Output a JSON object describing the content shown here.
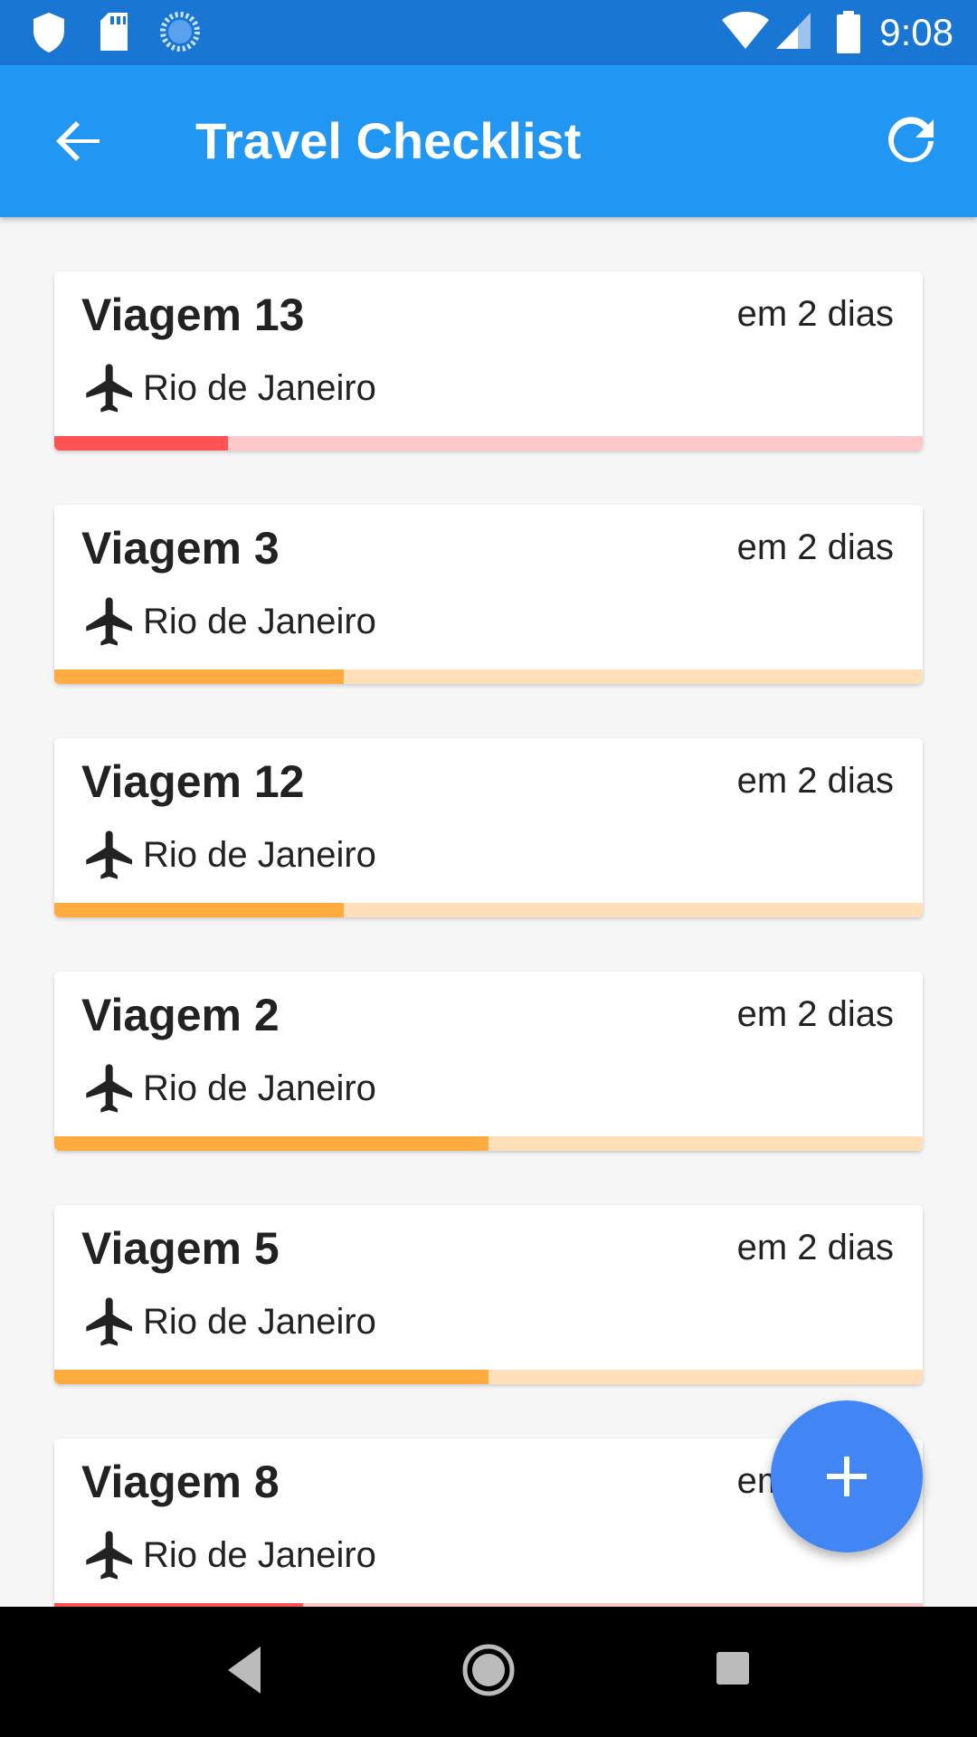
{
  "status_bar": {
    "time": "9:08",
    "icons": [
      "shield-icon",
      "sd-card-icon",
      "loading-icon",
      "wifi-icon",
      "signal-icon",
      "battery-icon"
    ]
  },
  "app_bar": {
    "title": "Travel Checklist",
    "back_icon": "arrow-back-icon",
    "refresh_icon": "refresh-icon",
    "color": "#2196f3"
  },
  "trips": [
    {
      "name": "Viagem 13",
      "due": "em 2 dias",
      "destination": "Rio de Janeiro",
      "progress": 0.2,
      "fill_color": "#ff5252",
      "track_color": "#ffc9c9"
    },
    {
      "name": "Viagem 3",
      "due": "em 2 dias",
      "destination": "Rio de Janeiro",
      "progress": 0.333,
      "fill_color": "#ffab40",
      "track_color": "#ffe0b8"
    },
    {
      "name": "Viagem 12",
      "due": "em 2 dias",
      "destination": "Rio de Janeiro",
      "progress": 0.333,
      "fill_color": "#ffab40",
      "track_color": "#ffe0b8"
    },
    {
      "name": "Viagem 2",
      "due": "em 2 dias",
      "destination": "Rio de Janeiro",
      "progress": 0.5,
      "fill_color": "#ffab40",
      "track_color": "#ffe0b8"
    },
    {
      "name": "Viagem 5",
      "due": "em 2 dias",
      "destination": "Rio de Janeiro",
      "progress": 0.5,
      "fill_color": "#ffab40",
      "track_color": "#ffe0b8"
    },
    {
      "name": "Viagem 8",
      "due": "em 2 dias",
      "destination": "Rio de Janeiro",
      "progress": 0.286,
      "fill_color": "#ff5252",
      "track_color": "#ffc9c9"
    }
  ],
  "fab": {
    "icon": "plus-icon",
    "color": "#4285f4"
  },
  "nav_bar": {
    "icons": [
      "nav-back-icon",
      "nav-home-icon",
      "nav-recents-icon"
    ]
  }
}
